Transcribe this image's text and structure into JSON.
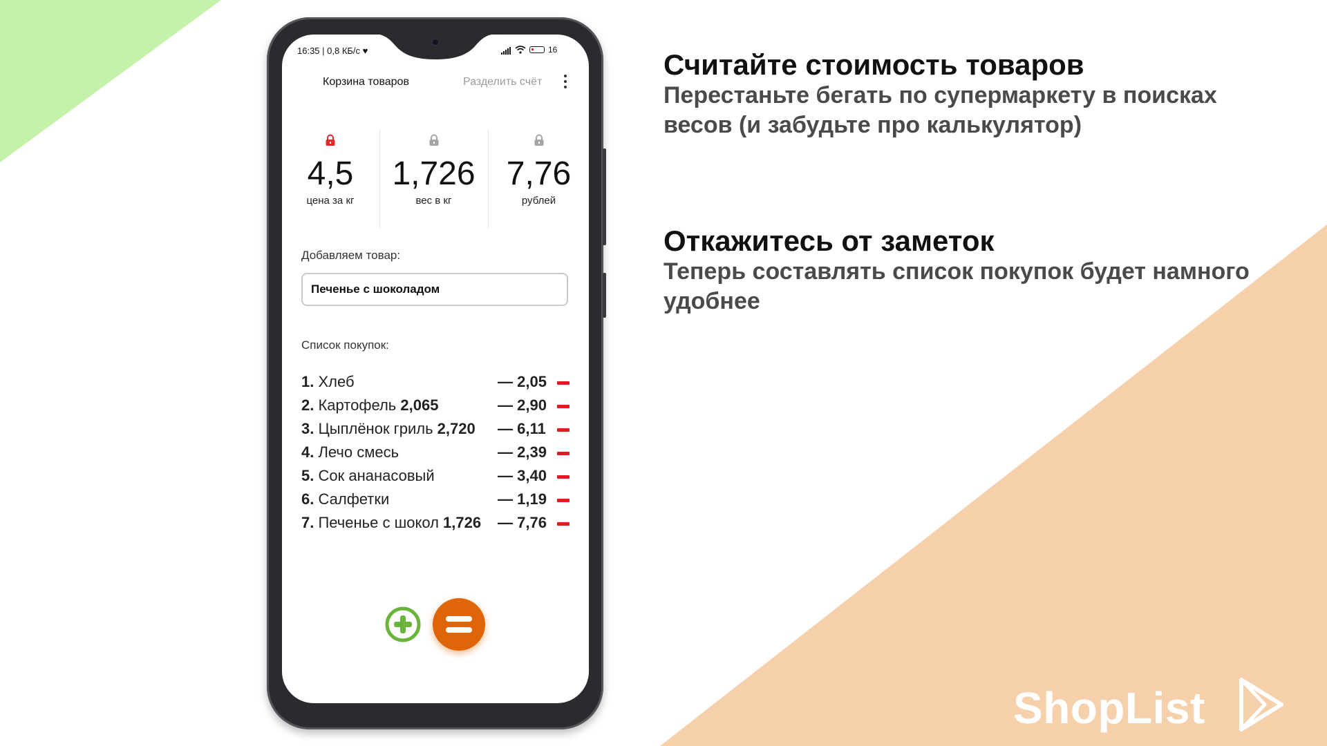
{
  "colors": {
    "green_bg": "#c4f2a8",
    "peach_bg": "#f6d0ab",
    "accent_orange": "#df6608",
    "accent_green": "#6ab43c",
    "remove_red": "#d62020",
    "lock_red": "#e0282c"
  },
  "status_bar": {
    "time_info": "16:35 | 0,8 КБ/с ♥",
    "battery": "16"
  },
  "app_header": {
    "title": "Корзина товаров",
    "split_bill": "Разделить счёт",
    "menu_icon": "more-vertical-icon"
  },
  "stats": [
    {
      "value": "4,5",
      "label": "цена за кг",
      "lock": "locked",
      "lock_color": "#e0282c"
    },
    {
      "value": "1,726",
      "label": "вес в кг",
      "lock": "unlocked",
      "lock_color": "#a5a5a5"
    },
    {
      "value": "7,76",
      "label": "рублей",
      "lock": "unlocked",
      "lock_color": "#a5a5a5"
    }
  ],
  "add_item": {
    "label": "Добавляем товар:",
    "value": "Печенье с шоколадом"
  },
  "shopping_list": {
    "label": "Список покупок:",
    "items": [
      {
        "num": "1.",
        "name": "Хлеб",
        "qty": "",
        "price": "— 2,05"
      },
      {
        "num": "2.",
        "name": "Картофель",
        "qty": "2,065",
        "price": "— 2,90"
      },
      {
        "num": "3.",
        "name": "Цыплёнок гриль",
        "qty": "2,720",
        "price": "— 6,11"
      },
      {
        "num": "4.",
        "name": "Лечо смесь",
        "qty": "",
        "price": "— 2,39"
      },
      {
        "num": "5.",
        "name": "Сок ананасовый",
        "qty": "",
        "price": "— 3,40"
      },
      {
        "num": "6.",
        "name": "Салфетки",
        "qty": "",
        "price": "— 1,19"
      },
      {
        "num": "7.",
        "name": "Печенье с шокол",
        "qty": "1,726",
        "price": "— 7,76"
      }
    ]
  },
  "actions": {
    "add_icon": "plus-circle-icon",
    "calc_icon": "equals-icon"
  },
  "promo": {
    "heading1": "Считайте стоимость товаров",
    "sub1": "Перестаньте бегать по супермаркету в поисках весов (и забудьте про калькулятор)",
    "heading2": "Откажитесь от заметок",
    "sub2": "Теперь составлять список покупок будет намного удобнее"
  },
  "brand": {
    "name": "ShopList",
    "logo_icon": "play-store-icon"
  }
}
